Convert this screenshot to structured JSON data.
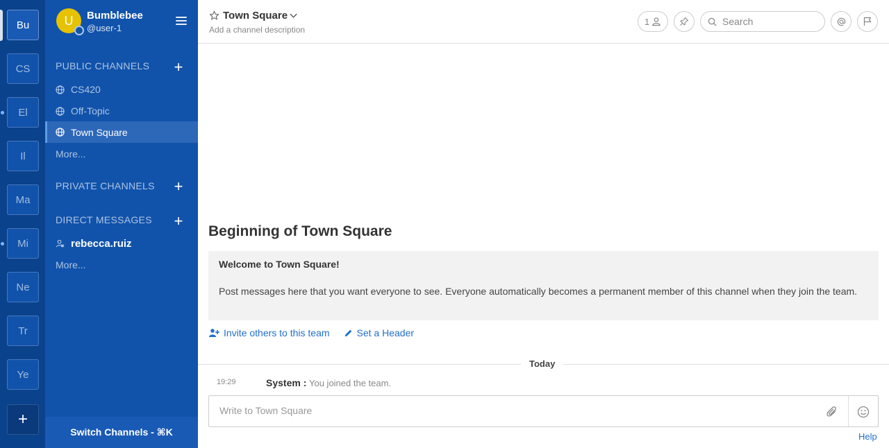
{
  "team_sidebar": {
    "teams": [
      {
        "initials": "Bu",
        "active": true
      },
      {
        "initials": "CS"
      },
      {
        "initials": "El",
        "unread": true
      },
      {
        "initials": "Il"
      },
      {
        "initials": "Ma"
      },
      {
        "initials": "Mi",
        "unread": true
      },
      {
        "initials": "Ne"
      },
      {
        "initials": "Tr"
      },
      {
        "initials": "Ye"
      }
    ],
    "add_label": "+"
  },
  "channel_sidebar": {
    "avatar_initial": "U",
    "team_name": "Bumblebee",
    "username": "@user-1",
    "public_channels_title": "PUBLIC CHANNELS",
    "public_channels": [
      {
        "name": "CS420"
      },
      {
        "name": "Off-Topic"
      },
      {
        "name": "Town Square",
        "active": true
      }
    ],
    "public_more": "More...",
    "private_channels_title": "PRIVATE CHANNELS",
    "direct_messages_title": "DIRECT MESSAGES",
    "direct_messages": [
      {
        "name": "rebecca.ruiz"
      }
    ],
    "dm_more": "More...",
    "switch_channels": "Switch Channels - ⌘K"
  },
  "channel_header": {
    "title": "Town Square",
    "description": "Add a channel description",
    "member_count": "1",
    "search_placeholder": "Search"
  },
  "intro": {
    "title": "Beginning of Town Square",
    "welcome": "Welcome to Town Square!",
    "description": "Post messages here that you want everyone to see. Everyone automatically becomes a permanent member of this channel when they join the team.",
    "invite_link": "Invite others to this team",
    "header_link": "Set a Header"
  },
  "messages": {
    "date_separator": "Today",
    "posts": [
      {
        "time": "19:29",
        "user": "System :",
        "text": "You joined the team."
      }
    ]
  },
  "composer": {
    "placeholder": "Write to Town Square"
  },
  "help_label": "Help",
  "colors": {
    "team_sidebar_bg": "#0b428c",
    "channel_sidebar_bg": "#1153ab",
    "link": "#2170c9",
    "avatar": "#e6c200"
  }
}
